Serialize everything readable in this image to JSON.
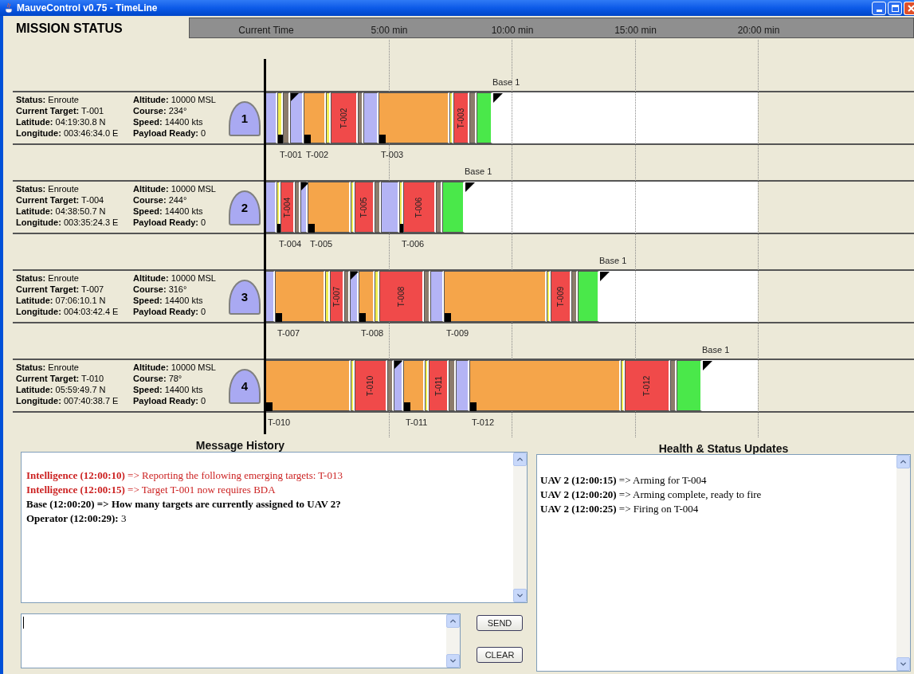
{
  "window": {
    "title": "MauveControl v0.75 - TimeLine"
  },
  "header": {
    "title": "MISSION STATUS",
    "ticks": [
      "Current Time",
      "5:00 min",
      "10:00 min",
      "15:00 min",
      "20:00 min"
    ]
  },
  "uavs": [
    {
      "number": "1",
      "base": "Base 1",
      "left_fields": [
        {
          "label": "Status:",
          "value": "Enroute"
        },
        {
          "label": "Current Target:",
          "value": "T-001"
        },
        {
          "label": "Latitude:",
          "value": "04:19:30.8 N"
        },
        {
          "label": "Longitude:",
          "value": "003:46:34.0 E"
        }
      ],
      "right_fields": [
        {
          "label": "Altitude:",
          "value": "10000 MSL"
        },
        {
          "label": "Course:",
          "value": "234°"
        },
        {
          "label": "Speed:",
          "value": "14400 kts"
        },
        {
          "label": "Payload Ready:",
          "value": "0"
        }
      ],
      "segments": [
        {
          "color": "#b4b4f5",
          "flag": false
        },
        {
          "color": "#f2ee52",
          "flag": false,
          "marker": "T-001"
        },
        {
          "color": "#8c7c6c",
          "flag": false
        },
        {
          "color": "#b4b4f5",
          "flag": true
        },
        {
          "color": "#f5a54a",
          "flag": false,
          "marker": "T-002"
        },
        {
          "color": "#f2ee52",
          "flag": false
        },
        {
          "color": "#f04a4a",
          "flag": false,
          "label": "T-002"
        },
        {
          "color": "#8c7c6c",
          "flag": false
        },
        {
          "color": "#b4b4f5",
          "flag": false
        },
        {
          "color": "#f5a54a",
          "flag": false,
          "marker": "T-003"
        },
        {
          "color": "#f2ee52",
          "flag": false
        },
        {
          "color": "#f04a4a",
          "flag": false,
          "label": "T-003"
        },
        {
          "color": "#8c7c6c",
          "flag": false
        },
        {
          "color": "#4ae84a",
          "flag": false
        }
      ]
    },
    {
      "number": "2",
      "base": "Base 1",
      "left_fields": [
        {
          "label": "Status:",
          "value": "Enroute"
        },
        {
          "label": "Current Target:",
          "value": "T-004"
        },
        {
          "label": "Latitude:",
          "value": "04:38:50.7 N"
        },
        {
          "label": "Longitude:",
          "value": "003:35:24.3 E"
        }
      ],
      "right_fields": [
        {
          "label": "Altitude:",
          "value": "10000 MSL"
        },
        {
          "label": "Course:",
          "value": "244°"
        },
        {
          "label": "Speed:",
          "value": "14400 kts"
        },
        {
          "label": "Payload Ready:",
          "value": "0"
        }
      ],
      "segments": [
        {
          "color": "#b4b4f5",
          "flag": false
        },
        {
          "color": "#f2ee52",
          "flag": false,
          "marker": "T-004"
        },
        {
          "color": "#f04a4a",
          "flag": false,
          "label": "T-004"
        },
        {
          "color": "#8c7c6c",
          "flag": false
        },
        {
          "color": "#b4b4f5",
          "flag": true
        },
        {
          "color": "#f5a54a",
          "flag": false,
          "marker": "T-005"
        },
        {
          "color": "#f2ee52",
          "flag": false
        },
        {
          "color": "#f04a4a",
          "flag": false,
          "label": "T-005"
        },
        {
          "color": "#8c7c6c",
          "flag": false
        },
        {
          "color": "#b4b4f5",
          "flag": false
        },
        {
          "color": "#f2ee52",
          "flag": false,
          "marker": "T-006"
        },
        {
          "color": "#f04a4a",
          "flag": false,
          "label": "T-006"
        },
        {
          "color": "#8c7c6c",
          "flag": false
        },
        {
          "color": "#4ae84a",
          "flag": false
        }
      ]
    },
    {
      "number": "3",
      "base": "Base 1",
      "left_fields": [
        {
          "label": "Status:",
          "value": "Enroute"
        },
        {
          "label": "Current Target:",
          "value": "T-007"
        },
        {
          "label": "Latitude:",
          "value": "07:06:10.1 N"
        },
        {
          "label": "Longitude:",
          "value": "004:03:42.4 E"
        }
      ],
      "right_fields": [
        {
          "label": "Altitude:",
          "value": "10000 MSL"
        },
        {
          "label": "Course:",
          "value": "316°"
        },
        {
          "label": "Speed:",
          "value": "14400 kts"
        },
        {
          "label": "Payload Ready:",
          "value": "0"
        }
      ],
      "segments": [
        {
          "color": "#b4b4f5",
          "flag": false
        },
        {
          "color": "#f5a54a",
          "flag": false,
          "marker": "T-007"
        },
        {
          "color": "#f2ee52",
          "flag": false
        },
        {
          "color": "#f04a4a",
          "flag": false,
          "label": "T-007"
        },
        {
          "color": "#8c7c6c",
          "flag": false
        },
        {
          "color": "#b4b4f5",
          "flag": true
        },
        {
          "color": "#f5a54a",
          "flag": false,
          "marker": "T-008"
        },
        {
          "color": "#f2ee52",
          "flag": false
        },
        {
          "color": "#f04a4a",
          "flag": false,
          "label": "T-008"
        },
        {
          "color": "#8c7c6c",
          "flag": false
        },
        {
          "color": "#b4b4f5",
          "flag": false
        },
        {
          "color": "#f5a54a",
          "flag": false,
          "marker": "T-009"
        },
        {
          "color": "#f2ee52",
          "flag": false
        },
        {
          "color": "#f04a4a",
          "flag": false,
          "label": "T-009"
        },
        {
          "color": "#8c7c6c",
          "flag": false
        },
        {
          "color": "#4ae84a",
          "flag": false
        }
      ]
    },
    {
      "number": "4",
      "base": "Base 1",
      "left_fields": [
        {
          "label": "Status:",
          "value": "Enroute"
        },
        {
          "label": "Current Target:",
          "value": "T-010"
        },
        {
          "label": "Latitude:",
          "value": "05:59:49.7 N"
        },
        {
          "label": "Longitude:",
          "value": "007:40:38.7 E"
        }
      ],
      "right_fields": [
        {
          "label": "Altitude:",
          "value": "10000 MSL"
        },
        {
          "label": "Course:",
          "value": "78°"
        },
        {
          "label": "Speed:",
          "value": "14400 kts"
        },
        {
          "label": "Payload Ready:",
          "value": "0"
        }
      ],
      "segments": [
        {
          "color": "#f5a54a",
          "flag": false,
          "marker": "T-010"
        },
        {
          "color": "#f2ee52",
          "flag": false
        },
        {
          "color": "#f04a4a",
          "flag": false,
          "label": "T-010"
        },
        {
          "color": "#8c7c6c",
          "flag": false
        },
        {
          "color": "#b4b4f5",
          "flag": true
        },
        {
          "color": "#f5a54a",
          "flag": false,
          "marker": "T-011"
        },
        {
          "color": "#f2ee52",
          "flag": false
        },
        {
          "color": "#f04a4a",
          "flag": false,
          "label": "T-011"
        },
        {
          "color": "#8c7c6c",
          "flag": false
        },
        {
          "color": "#b4b4f5",
          "flag": false
        },
        {
          "color": "#f5a54a",
          "flag": false,
          "marker": "T-012"
        },
        {
          "color": "#f2ee52",
          "flag": false
        },
        {
          "color": "#f04a4a",
          "flag": false,
          "label": "T-012"
        },
        {
          "color": "#8c7c6c",
          "flag": false
        },
        {
          "color": "#4ae84a",
          "flag": false
        }
      ]
    }
  ],
  "message_history": {
    "title": "Message History",
    "messages": [
      {
        "text": "**Intelligence (12:00:10)** => Reporting the following emerging targets: T-013",
        "color": "#cc2222",
        "bold": false
      },
      {
        "text": "**Intelligence (12:00:15)** => Target T-001 now requires BDA",
        "color": "#cc2222",
        "bold": false
      },
      {
        "text": "Base (12:00:20) => How many targets are currently assigned to UAV 2?",
        "color": "#000000",
        "bold": true
      },
      {
        "text": "**Operator (12:00:29):** 3",
        "color": "#000000",
        "bold": false
      }
    ]
  },
  "buttons": [
    "SEND",
    "CLEAR"
  ],
  "health": {
    "title": "Health & Status Updates",
    "messages": [
      {
        "text": "**UAV 2 (12:00:15)** => Arming for T-004"
      },
      {
        "text": "**UAV 2 (12:00:20)** => Arming complete, ready to fire"
      },
      {
        "text": "**UAV 2 (12:00:25)** => Firing on T-004"
      }
    ]
  }
}
